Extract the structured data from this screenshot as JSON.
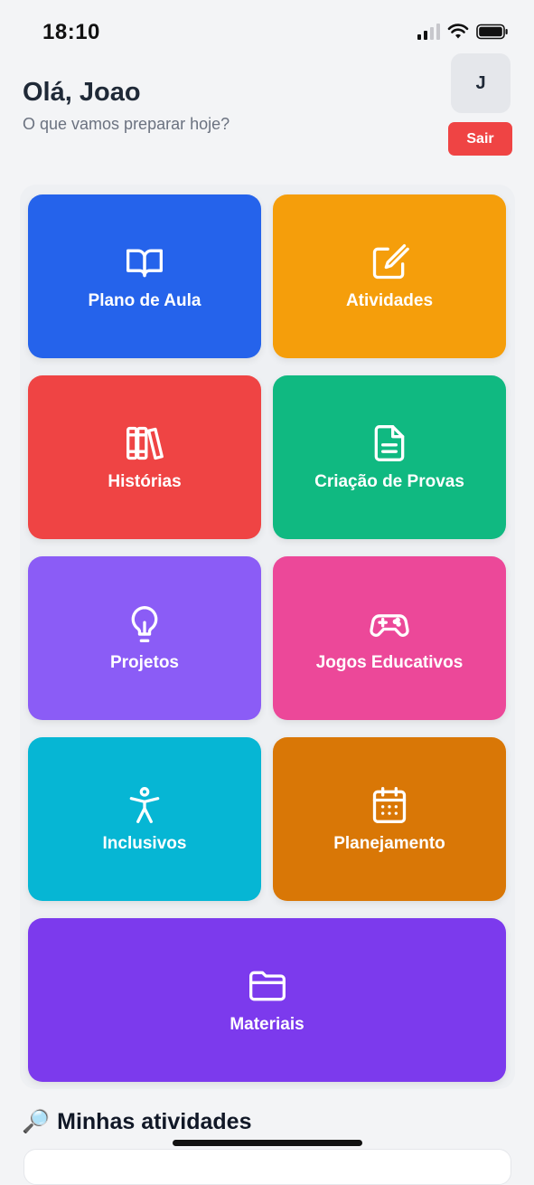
{
  "status_bar": {
    "time": "18:10"
  },
  "header": {
    "greeting": "Olá, Joao",
    "subtitle": "O que vamos preparar hoje?",
    "avatar_initial": "J",
    "logout_label": "Sair"
  },
  "tiles": [
    {
      "label": "Plano de Aula",
      "icon": "book-open-icon",
      "color": "#2563eb"
    },
    {
      "label": "Atividades",
      "icon": "edit-square-icon",
      "color": "#f59e0b"
    },
    {
      "label": "Histórias",
      "icon": "books-icon",
      "color": "#ef4444"
    },
    {
      "label": "Criação de Provas",
      "icon": "document-icon",
      "color": "#10b981"
    },
    {
      "label": "Projetos",
      "icon": "lightbulb-icon",
      "color": "#8b5cf6"
    },
    {
      "label": "Jogos Educativos",
      "icon": "gamepad-icon",
      "color": "#ec4899"
    },
    {
      "label": "Inclusivos",
      "icon": "accessibility-icon",
      "color": "#06b6d4"
    },
    {
      "label": "Planejamento",
      "icon": "calendar-icon",
      "color": "#d97706"
    },
    {
      "label": "Materiais",
      "icon": "folder-icon",
      "color": "#7c3aed"
    }
  ],
  "section": {
    "title": "Minhas atividades",
    "icon": "magnifier-emoji"
  }
}
